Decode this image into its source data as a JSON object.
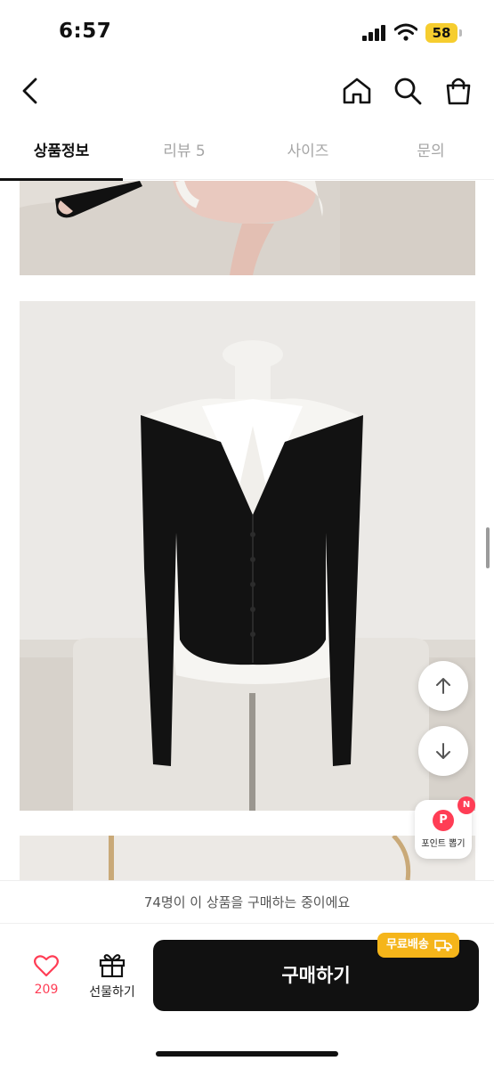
{
  "status_bar": {
    "time": "6:57",
    "battery": "58"
  },
  "header": {
    "back_icon": "chevron-left-icon",
    "home_icon": "home-icon",
    "search_icon": "search-icon",
    "cart_icon": "shopping-bag-icon"
  },
  "tabs": [
    {
      "label": "상품정보",
      "active": true
    },
    {
      "label": "리뷰 5",
      "active": false
    },
    {
      "label": "사이즈",
      "active": false
    },
    {
      "label": "문의",
      "active": false
    }
  ],
  "floating": {
    "scroll_up_icon": "arrow-up-icon",
    "scroll_down_icon": "arrow-down-icon",
    "point_badge": "P",
    "point_label": "포인트 뽑기",
    "new_badge": "N"
  },
  "notice": "74명이 이 상품을 구매하는 중이에요",
  "bottom_bar": {
    "like_count": "209",
    "gift_label": "선물하기",
    "buy_label": "구매하기",
    "shipping_badge": "무료배송"
  },
  "colors": {
    "accent": "#ff3d55",
    "shipping": "#f5b51a",
    "buy_button": "#111111"
  }
}
